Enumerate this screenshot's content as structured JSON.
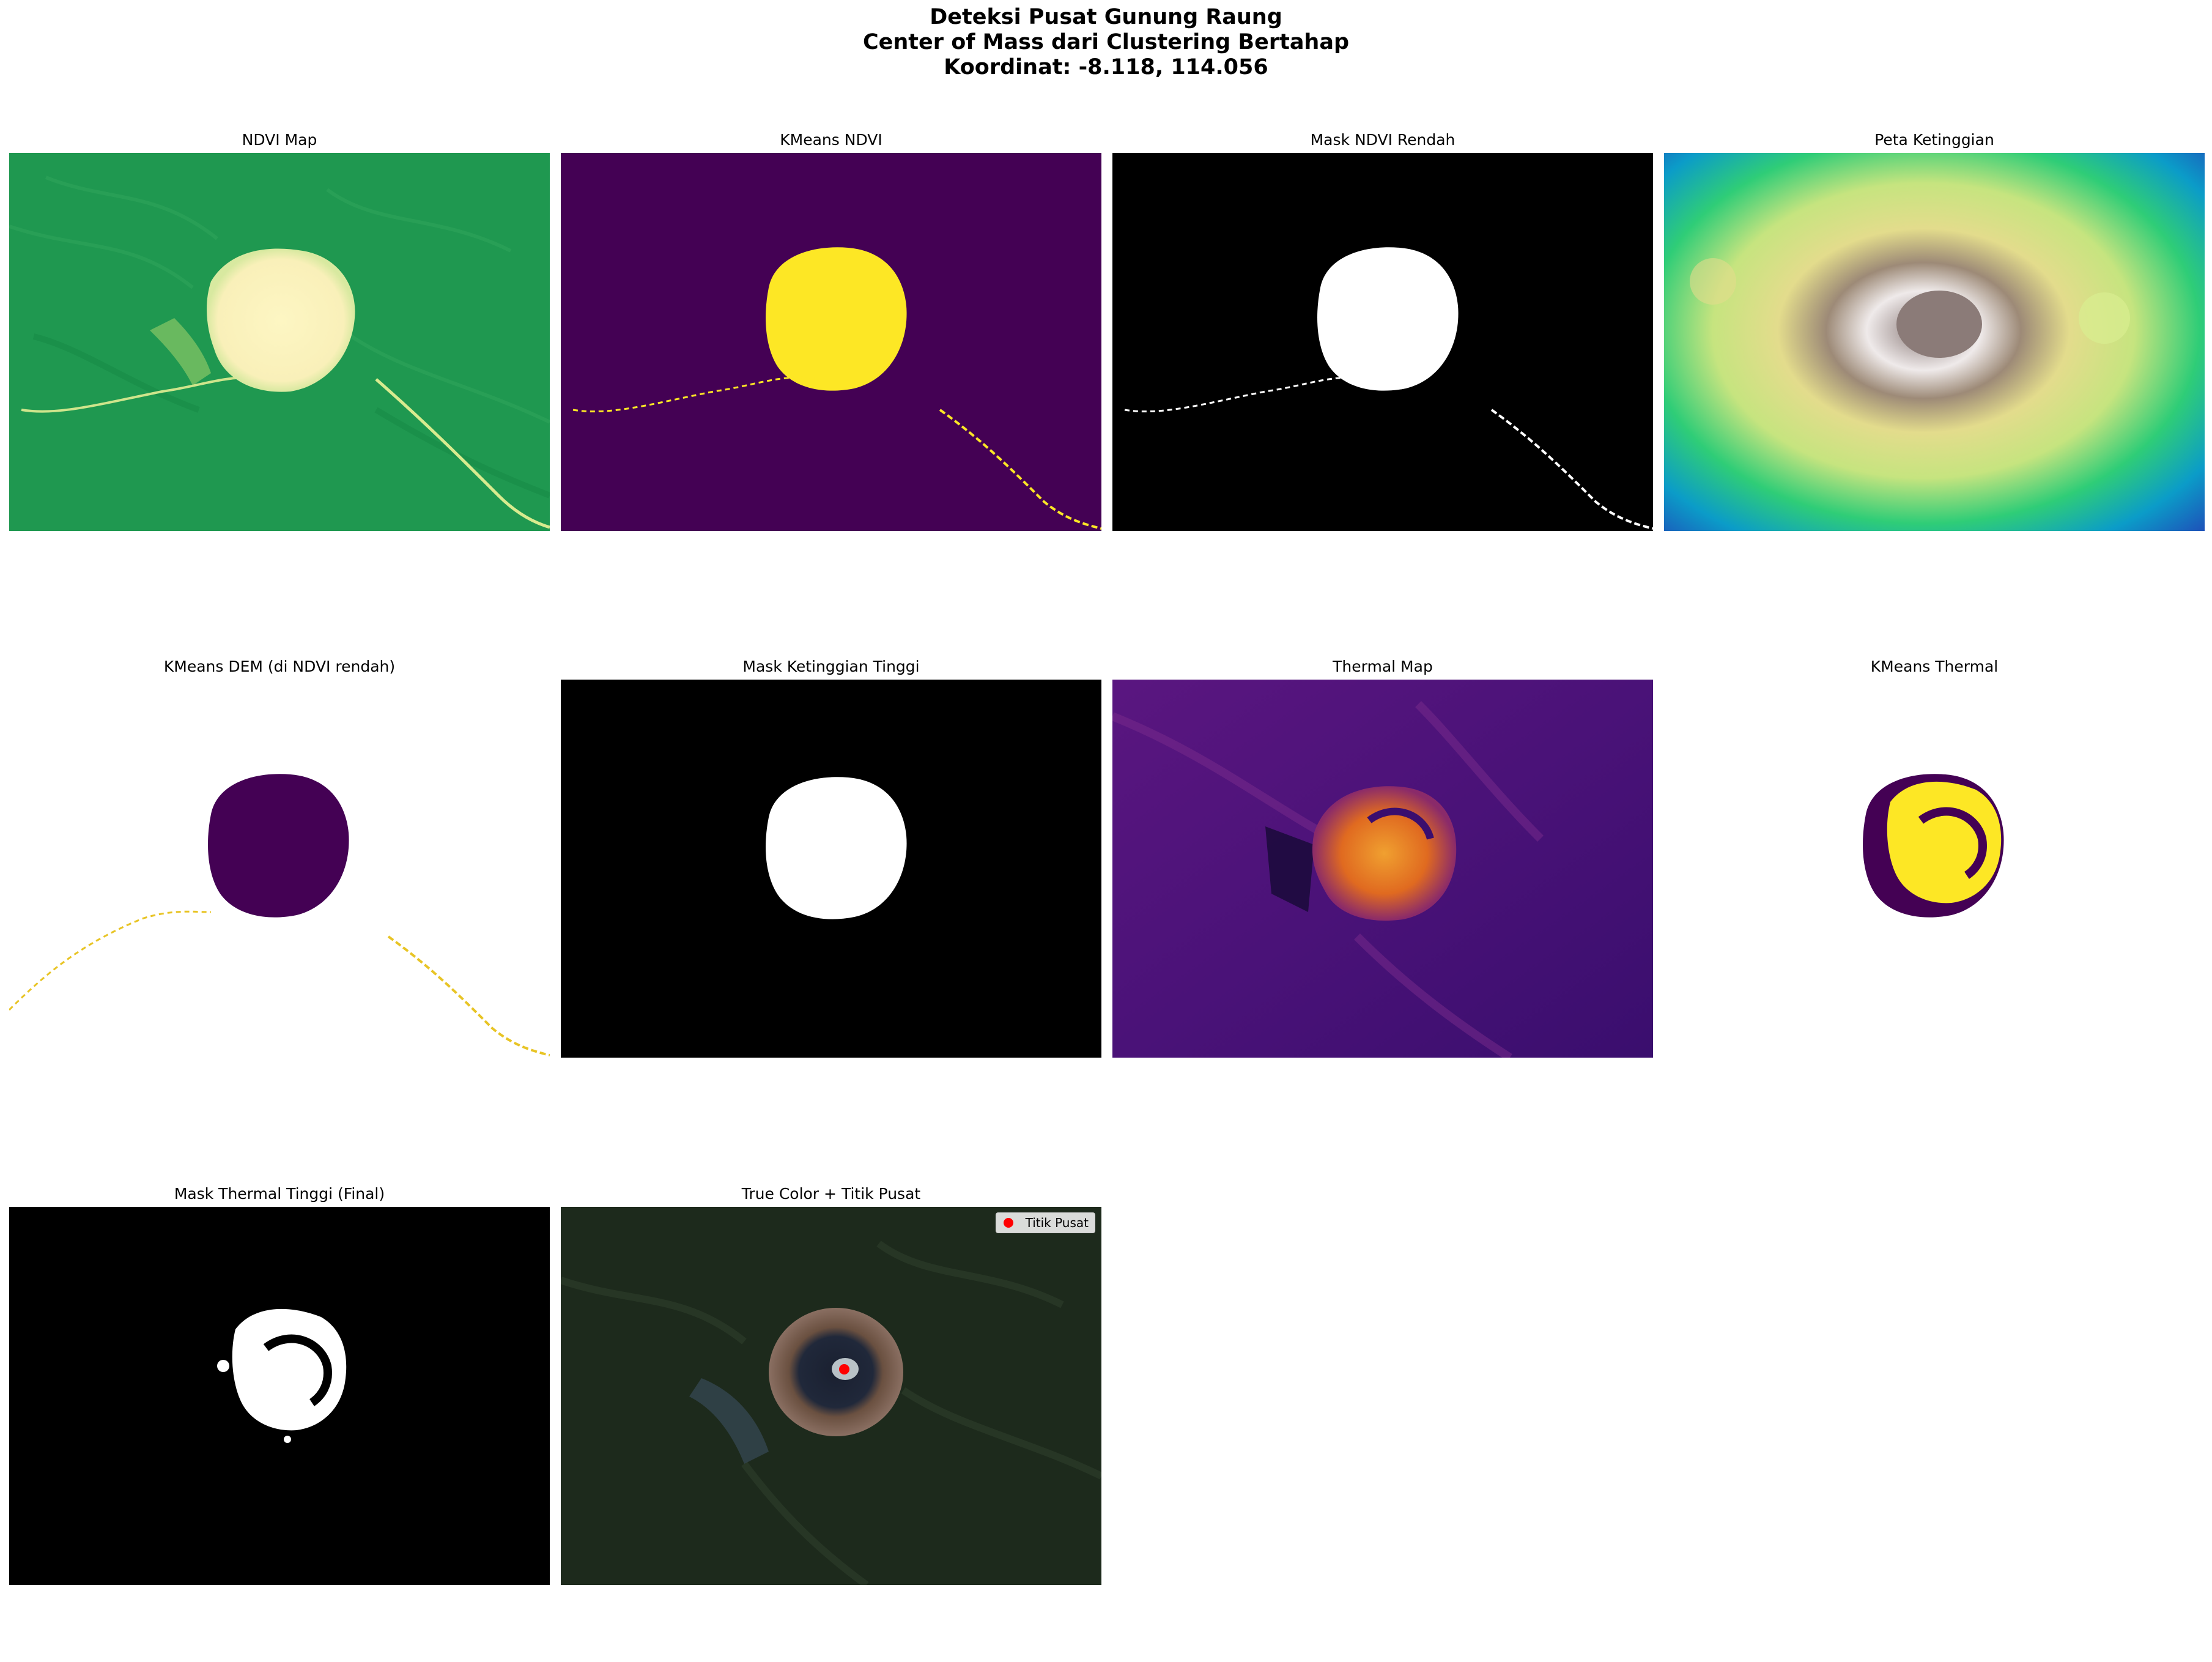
{
  "figure": {
    "title_line1": "Deteksi Pusat Gunung Raung",
    "title_line2": "Center of Mass dari Clustering Bertahap",
    "title_line3": "Koordinat: -8.118, 114.056"
  },
  "panels": [
    {
      "title": "NDVI Map"
    },
    {
      "title": "KMeans NDVI"
    },
    {
      "title": "Mask NDVI Rendah"
    },
    {
      "title": "Peta Ketinggian"
    },
    {
      "title": "KMeans DEM (di NDVI rendah)"
    },
    {
      "title": "Mask Ketinggian Tinggi"
    },
    {
      "title": "Thermal Map"
    },
    {
      "title": "KMeans Thermal"
    },
    {
      "title": "Mask Thermal Tinggi (Final)"
    },
    {
      "title": "True Color + Titik Pusat"
    }
  ],
  "legend": {
    "label": "Titik Pusat",
    "marker_color": "#ff0000"
  },
  "colors": {
    "ndvi_green": "#1f9850",
    "ndvi_low": "#fef9c5",
    "viridis_low": "#440154",
    "viridis_high": "#fde725",
    "inferno_dark": "#320a5e",
    "inferno_hot": "#fca50a"
  }
}
